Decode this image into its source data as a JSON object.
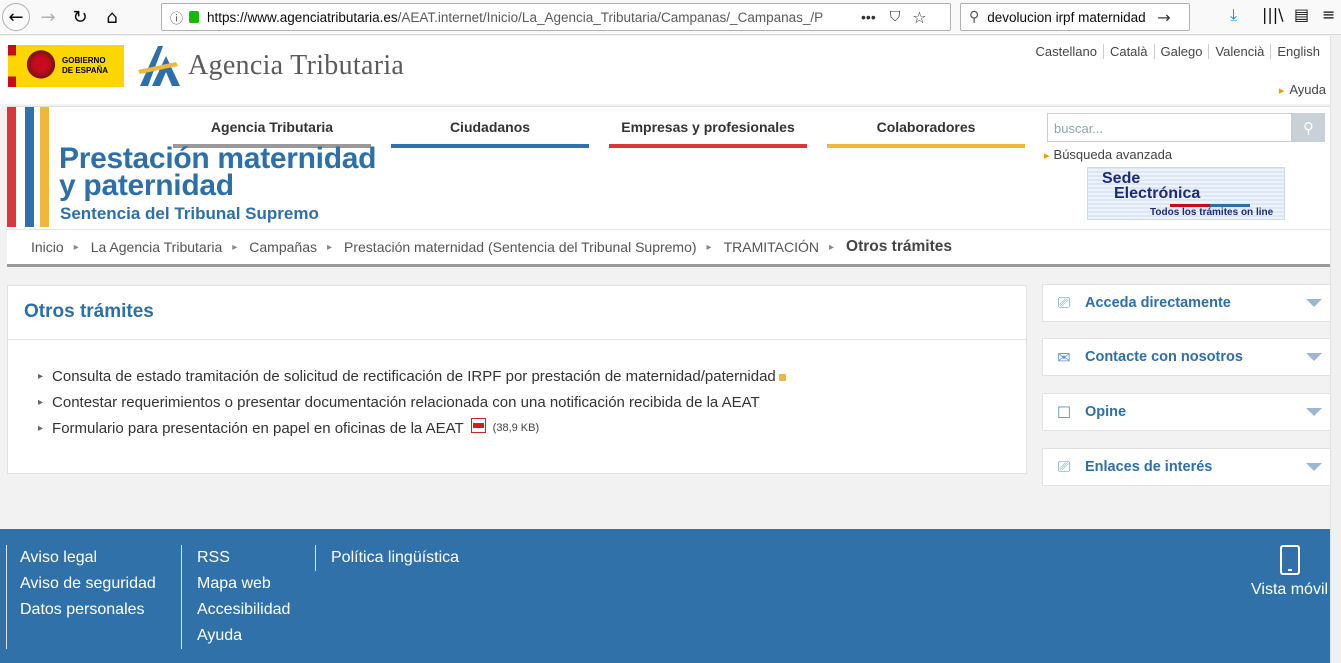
{
  "browser": {
    "url_host": "https://www.agenciatributaria.es",
    "url_path": "/AEAT.internet/Inicio/La_Agencia_Tributaria/Campanas/_Campanas_/P",
    "search_query": "devolucion irpf maternidad"
  },
  "header": {
    "gob_text_1": "GOBIERNO",
    "gob_text_2": "DE ESPAÑA",
    "agency_name": "Agencia Tributaria",
    "languages": [
      "Castellano",
      "Català",
      "Galego",
      "Valencià",
      "English"
    ],
    "help": "Ayuda"
  },
  "menu": [
    {
      "label": "Agencia Tributaria",
      "color": "#9a9a9a"
    },
    {
      "label": "Ciudadanos",
      "color": "#3171a9"
    },
    {
      "label": "Empresas y profesionales",
      "color": "#d9363e"
    },
    {
      "label": "Colaboradores",
      "color": "#f0b73b"
    }
  ],
  "banner": {
    "title_line1": "Prestación maternidad",
    "title_line2": "y paternidad",
    "subtitle": "Sentencia del Tribunal Supremo"
  },
  "search": {
    "placeholder": "buscar...",
    "advanced": "Búsqueda avanzada"
  },
  "sede": {
    "line1": "Sede",
    "line2": "Electrónica",
    "line3": "Todos los trámites on line"
  },
  "breadcrumb": [
    "Inicio",
    "La Agencia Tributaria",
    "Campañas",
    "Prestación maternidad (Sentencia del Tribunal Supremo)",
    "TRAMITACIÓN",
    "Otros trámites"
  ],
  "main": {
    "title": "Otros trámites",
    "items": [
      "Consulta de estado tramitación de solicitud de rectificación de IRPF por prestación de maternidad/paternidad",
      "Contestar requerimientos o presentar documentación relacionada con una notificación recibida de la AEAT",
      "Formulario para presentación en papel en oficinas de la AEAT"
    ],
    "pdf_size": "(38,9 KB)"
  },
  "sidebar": [
    {
      "label": "Acceda directamente",
      "icon": "laptop-icon"
    },
    {
      "label": "Contacte con nosotros",
      "icon": "envelope-icon"
    },
    {
      "label": "Opine",
      "icon": "speech-bubble-icon"
    },
    {
      "label": "Enlaces de interés",
      "icon": "link-icon"
    }
  ],
  "footer": {
    "col1": [
      "Aviso legal",
      "Aviso de seguridad",
      "Datos personales"
    ],
    "col2": [
      "RSS",
      "Mapa web",
      "Accesibilidad",
      "Ayuda"
    ],
    "col3": [
      "Política lingüística"
    ],
    "mobile": "Vista móvil"
  }
}
